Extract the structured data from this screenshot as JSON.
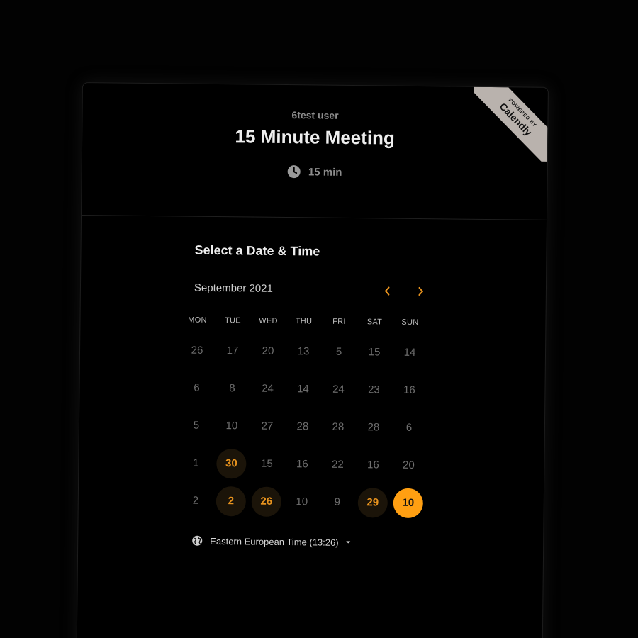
{
  "header": {
    "owner": "6test user",
    "title": "15 Minute Meeting",
    "duration": "15 min",
    "duration_icon": "clock-icon"
  },
  "ribbon": {
    "small": "POWERED BY",
    "brand": "Calendly"
  },
  "calendar": {
    "section_title": "Select a Date & Time",
    "month": "September 2021",
    "prev_icon": "chevron-left-icon",
    "next_icon": "chevron-right-icon",
    "weekdays": [
      "MON",
      "TUE",
      "WED",
      "THU",
      "FRI",
      "SAT",
      "SUN"
    ],
    "rows": [
      [
        {
          "v": "26"
        },
        {
          "v": "17"
        },
        {
          "v": "20"
        },
        {
          "v": "13"
        },
        {
          "v": "5"
        },
        {
          "v": "15"
        },
        {
          "v": "14"
        }
      ],
      [
        {
          "v": "6"
        },
        {
          "v": "8"
        },
        {
          "v": "24"
        },
        {
          "v": "14"
        },
        {
          "v": "24"
        },
        {
          "v": "23"
        },
        {
          "v": "16"
        }
      ],
      [
        {
          "v": "5"
        },
        {
          "v": "10"
        },
        {
          "v": "27"
        },
        {
          "v": "28"
        },
        {
          "v": "28"
        },
        {
          "v": "28"
        },
        {
          "v": "6"
        }
      ],
      [
        {
          "v": "1"
        },
        {
          "v": "30",
          "state": "available"
        },
        {
          "v": "15"
        },
        {
          "v": "16"
        },
        {
          "v": "22"
        },
        {
          "v": "16"
        },
        {
          "v": "20"
        }
      ],
      [
        {
          "v": "2"
        },
        {
          "v": "2",
          "state": "available"
        },
        {
          "v": "26",
          "state": "available"
        },
        {
          "v": "10"
        },
        {
          "v": "9"
        },
        {
          "v": "29",
          "state": "available"
        },
        {
          "v": "10",
          "state": "selected"
        }
      ]
    ]
  },
  "timezone": {
    "label": "Eastern European Time (13:26)",
    "icon": "globe-icon"
  },
  "colors": {
    "accent": "#ff9f12",
    "available_text": "#e8931e",
    "available_bg": "#1b1409",
    "background": "#000000",
    "ribbon": "#b9b2ad"
  }
}
